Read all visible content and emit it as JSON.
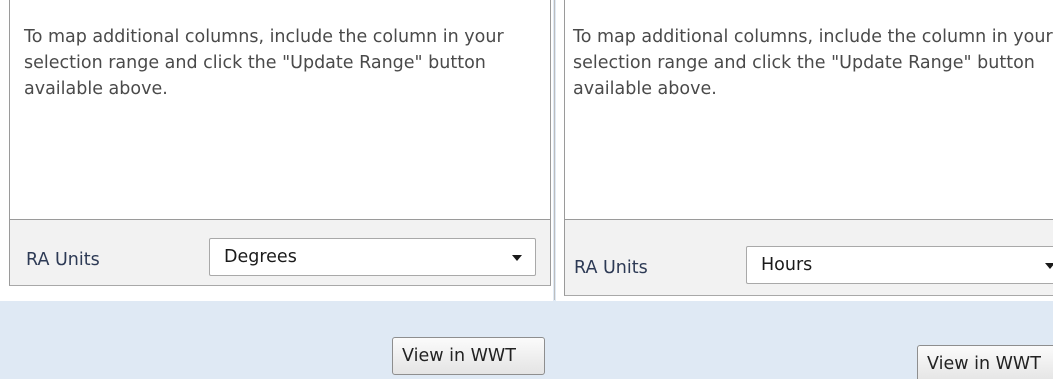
{
  "left_panel": {
    "info_text": "To map additional columns, include the column in your selection range and click the \"Update Range\" button available above.",
    "ra_units_label": "RA Units",
    "ra_units_value": "Degrees",
    "view_button_label": "View in WWT"
  },
  "right_panel": {
    "info_text": "To map additional columns, include the column in your selection range and click the \"Update Range\" button available above.",
    "ra_units_label": "RA Units",
    "ra_units_value": "Hours",
    "view_button_label": "View in WWT"
  },
  "colors": {
    "footer_background": "#dfe9f4",
    "units_row_background": "#f2f2f2",
    "label_text": "#2d3a55"
  }
}
